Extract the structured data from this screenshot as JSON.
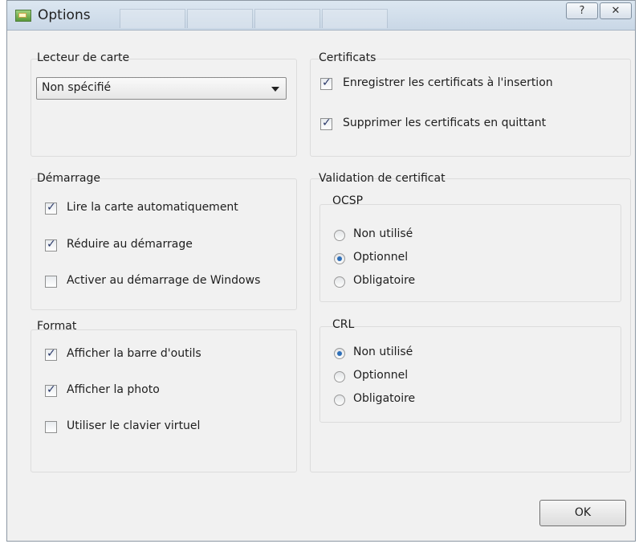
{
  "window": {
    "title": "Options",
    "help_label": "?",
    "close_label": "✕"
  },
  "reader_group": {
    "legend": "Lecteur de carte",
    "combo_value": "Non spécifié"
  },
  "certificates_group": {
    "legend": "Certificats",
    "options": [
      {
        "label": "Enregistrer les certificats à l'insertion",
        "checked": true
      },
      {
        "label": "Supprimer les certificats en quittant",
        "checked": true
      }
    ]
  },
  "startup_group": {
    "legend": "Démarrage",
    "options": [
      {
        "label": "Lire la carte automatiquement",
        "checked": true
      },
      {
        "label": "Réduire au démarrage",
        "checked": true
      },
      {
        "label": "Activer au démarrage de Windows",
        "checked": false
      }
    ]
  },
  "format_group": {
    "legend": "Format",
    "options": [
      {
        "label": "Afficher la barre d'outils",
        "checked": true
      },
      {
        "label": "Afficher la photo",
        "checked": true
      },
      {
        "label": "Utiliser le clavier virtuel",
        "checked": false
      }
    ]
  },
  "validation_group": {
    "legend": "Validation de certificat",
    "ocsp": {
      "legend": "OCSP",
      "options": [
        "Non utilisé",
        "Optionnel",
        "Obligatoire"
      ],
      "selected": "Optionnel"
    },
    "crl": {
      "legend": "CRL",
      "options": [
        "Non utilisé",
        "Optionnel",
        "Obligatoire"
      ],
      "selected": "Non utilisé"
    }
  },
  "ok_label": "OK"
}
